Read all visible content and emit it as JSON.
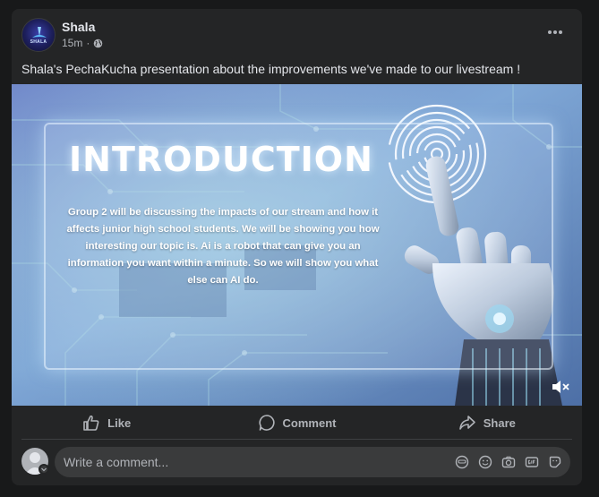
{
  "post": {
    "author": "Shala",
    "avatar_text": "SHALA",
    "time": "15m",
    "separator": "·",
    "audience_icon": "globe-icon",
    "caption": "Shala's PechaKucha presentation about the improvements we've made to our livestream !"
  },
  "slide": {
    "title": "INTRODUCTION",
    "body": "Group 2 will be discussing the impacts of our stream and how it affects junior high school students. We will be showing you how interesting our topic is. Ai is a robot that can give you an information you want within a minute. So we will show you what else can AI do."
  },
  "actions": {
    "like": "Like",
    "comment": "Comment",
    "share": "Share"
  },
  "comment_box": {
    "placeholder": "Write a comment..."
  },
  "colors": {
    "card_bg": "#242526",
    "page_bg": "#18191a",
    "secondary_text": "#b0b3b8"
  }
}
